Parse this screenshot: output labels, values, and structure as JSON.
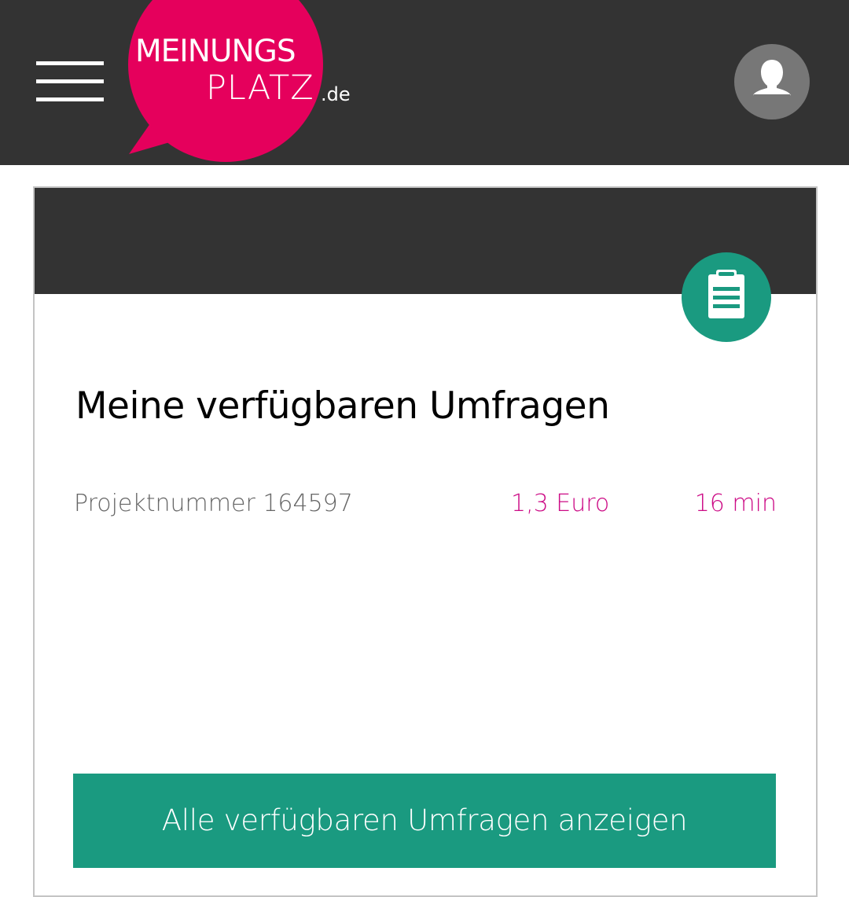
{
  "header": {
    "menu_icon": "hamburger-menu-icon",
    "logo": {
      "line1": "MEINUNGS",
      "line2": "PLATZ",
      "tld": ".de",
      "color": "#e5005c"
    },
    "account_icon": "user-avatar-icon"
  },
  "card": {
    "banner_icon": "clipboard-icon",
    "title": "Meine verfügbaren Umfragen",
    "surveys": [
      {
        "project": "Projektnummer 164597",
        "reward": "1,3 Euro",
        "duration": "16 min"
      }
    ],
    "button_label": "Alle verfügbaren Umfragen anzeigen"
  },
  "colors": {
    "header_bg": "#333333",
    "brand_pink": "#e5005c",
    "accent_green": "#1a9a80",
    "highlight_text": "#cc0a85",
    "muted_text": "#666666"
  }
}
